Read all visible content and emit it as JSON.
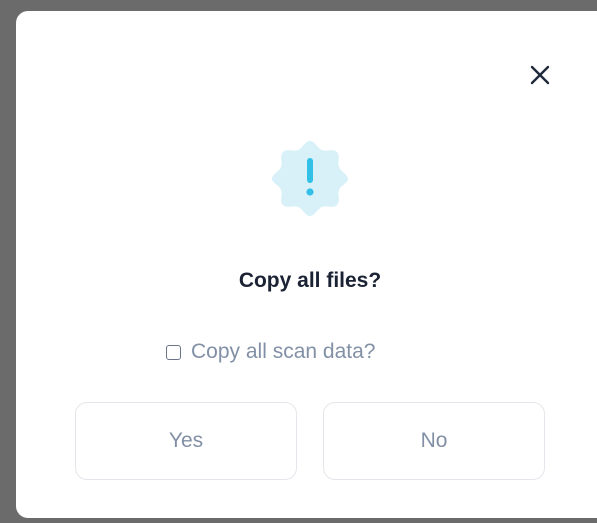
{
  "dialog": {
    "title": "Copy all files?",
    "checkbox": {
      "label": "Copy all scan data?",
      "checked": false
    },
    "buttons": {
      "yes_label": "Yes",
      "no_label": "No"
    },
    "icons": {
      "close": "close-icon",
      "warning": "exclamation-badge-icon"
    },
    "colors": {
      "badge_fill": "#d8f1f9",
      "badge_accent": "#33c0e7",
      "title_text": "#1a2233",
      "muted_text": "#8290a6"
    }
  }
}
